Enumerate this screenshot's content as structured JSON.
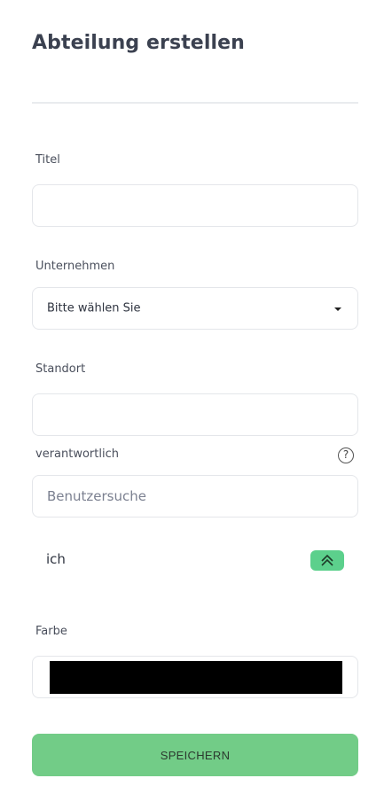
{
  "page": {
    "title": "Abteilung erstellen"
  },
  "form": {
    "title": {
      "label": "Titel",
      "value": ""
    },
    "company": {
      "label": "Unternehmen",
      "selected": "Bitte wählen Sie"
    },
    "location": {
      "label": "Standort",
      "value": ""
    },
    "responsible": {
      "label": "verantwortlich",
      "placeholder": "Benutzersuche",
      "help_icon": "question-circle-icon",
      "selected_user": "ich",
      "selected_user_icon": "double-chevron-up-icon"
    },
    "color": {
      "label": "Farbe",
      "value": "#000000"
    }
  },
  "actions": {
    "save_label": "SPEICHERN"
  },
  "colors": {
    "accent": "#72cc87",
    "badge": "#5cd08c",
    "border": "#e4e6ea"
  }
}
